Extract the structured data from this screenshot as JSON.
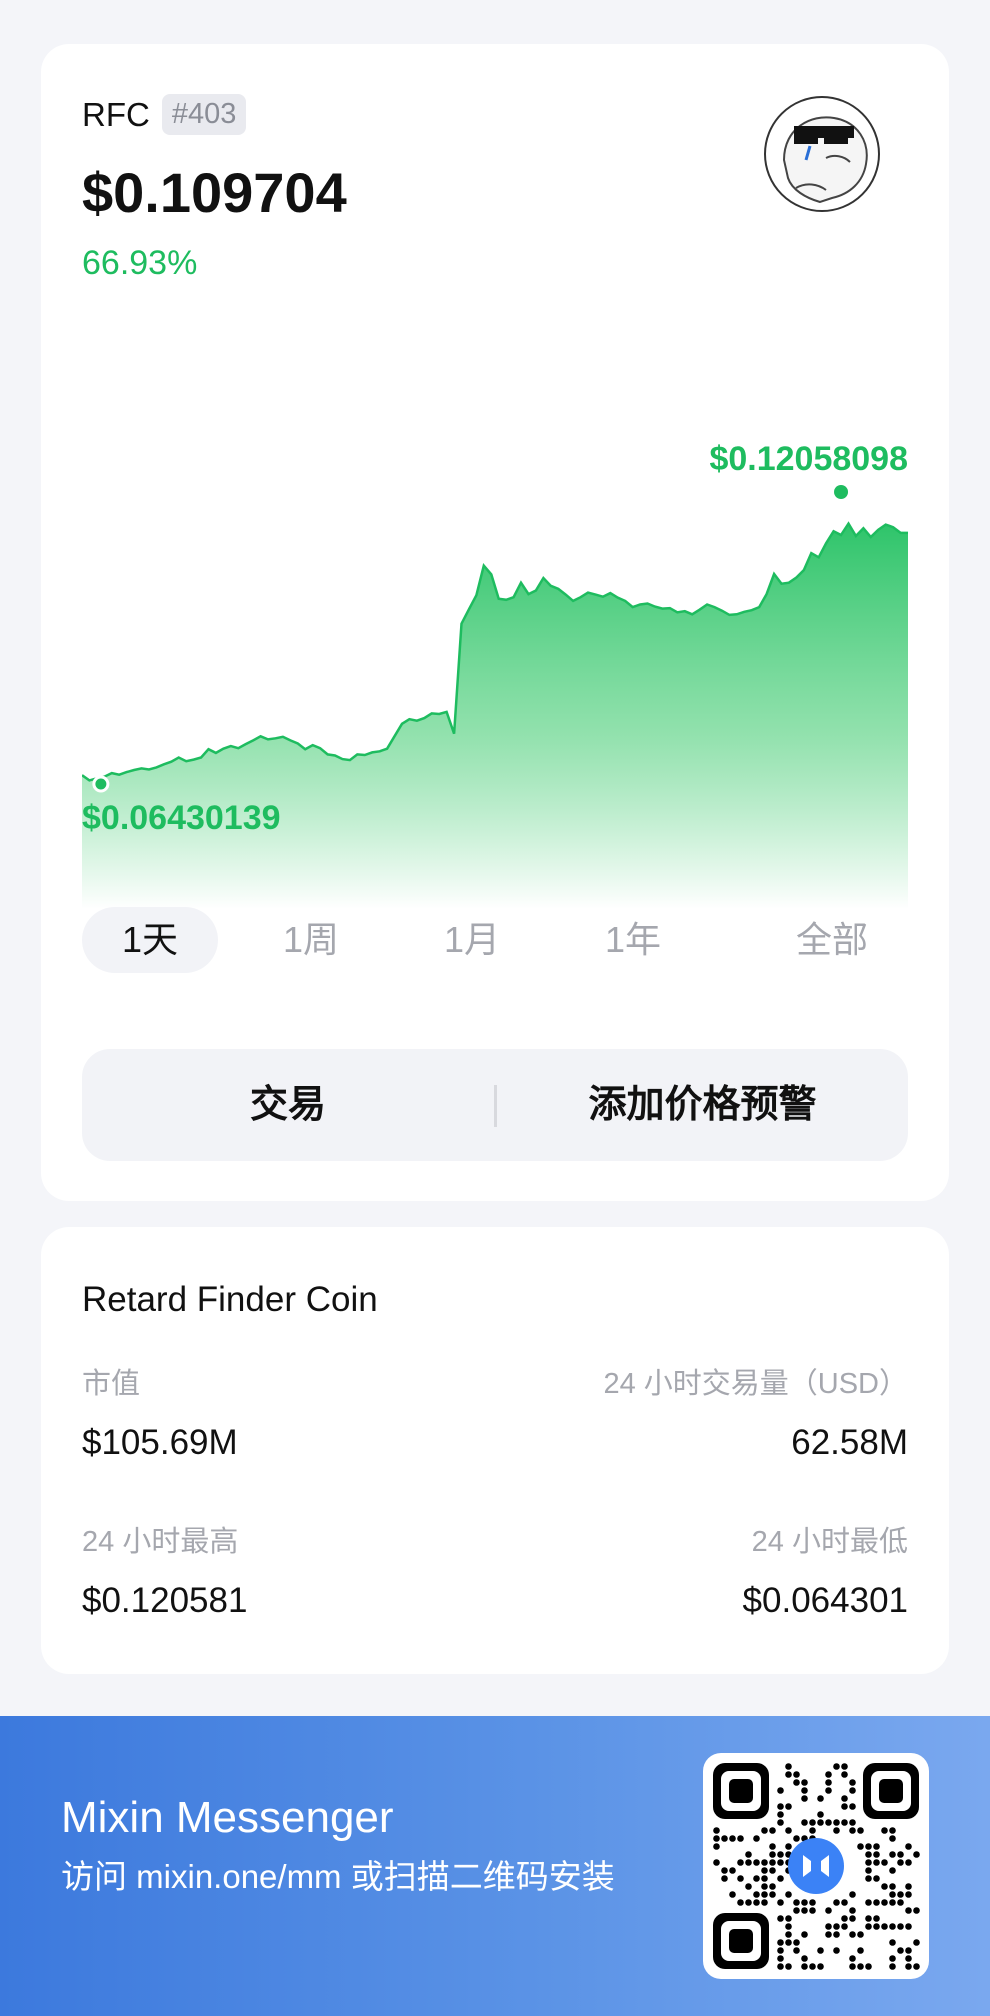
{
  "asset": {
    "symbol": "RFC",
    "rank": "#403",
    "price": "$0.109704",
    "change": "66.93%",
    "name": "Retard Finder Coin"
  },
  "chart_data": {
    "type": "area",
    "period": "1天",
    "high_label": "$0.12058098",
    "low_label": "$0.06430139",
    "high": 0.12058098,
    "low": 0.06430139,
    "color": "#1ebc5f",
    "values": [
      0.066,
      0.065,
      0.0654,
      0.0657,
      0.0664,
      0.0661,
      0.0666,
      0.067,
      0.0673,
      0.0671,
      0.0675,
      0.0681,
      0.0686,
      0.0694,
      0.0687,
      0.069,
      0.0694,
      0.071,
      0.0703,
      0.0711,
      0.0716,
      0.0712,
      0.072,
      0.0727,
      0.0735,
      0.0729,
      0.0731,
      0.0734,
      0.0727,
      0.0721,
      0.071,
      0.0718,
      0.0712,
      0.07,
      0.0698,
      0.0691,
      0.0689,
      0.07,
      0.0699,
      0.0704,
      0.0706,
      0.0711,
      0.0735,
      0.0759,
      0.0768,
      0.0765,
      0.077,
      0.0779,
      0.0778,
      0.0782,
      0.074,
      0.0952,
      0.098,
      0.1007,
      0.1064,
      0.1047,
      0.1,
      0.0998,
      0.1003,
      0.1031,
      0.1009,
      0.1016,
      0.104,
      0.1025,
      0.1019,
      0.1008,
      0.0996,
      0.1003,
      0.1012,
      0.1008,
      0.1004,
      0.1011,
      0.1002,
      0.0996,
      0.0984,
      0.0989,
      0.0991,
      0.0985,
      0.0981,
      0.0982,
      0.0974,
      0.0976,
      0.097,
      0.0979,
      0.0989,
      0.0984,
      0.0977,
      0.0969,
      0.097,
      0.0975,
      0.0978,
      0.0984,
      0.1009,
      0.1048,
      0.1029,
      0.1031,
      0.1041,
      0.1055,
      0.1088,
      0.108,
      0.1107,
      0.113,
      0.1123,
      0.1145,
      0.1121,
      0.1136,
      0.1119,
      0.1133,
      0.1143,
      0.1138,
      0.1127,
      0.1127
    ]
  },
  "ranges": [
    "1天",
    "1周",
    "1月",
    "1年",
    "全部"
  ],
  "active_range": "1天",
  "actions": {
    "trade": "交易",
    "add_alert": "添加价格预警"
  },
  "stats": {
    "market_cap_label": "市值",
    "market_cap": "$105.69M",
    "volume_label": "24 小时交易量（USD）",
    "volume": "62.58M",
    "high_label": "24 小时最高",
    "high": "$0.120581",
    "low_label": "24 小时最低",
    "low": "$0.064301"
  },
  "footer": {
    "title": "Mixin Messenger",
    "subtitle": "访问 mixin.one/mm 或扫描二维码安装"
  }
}
